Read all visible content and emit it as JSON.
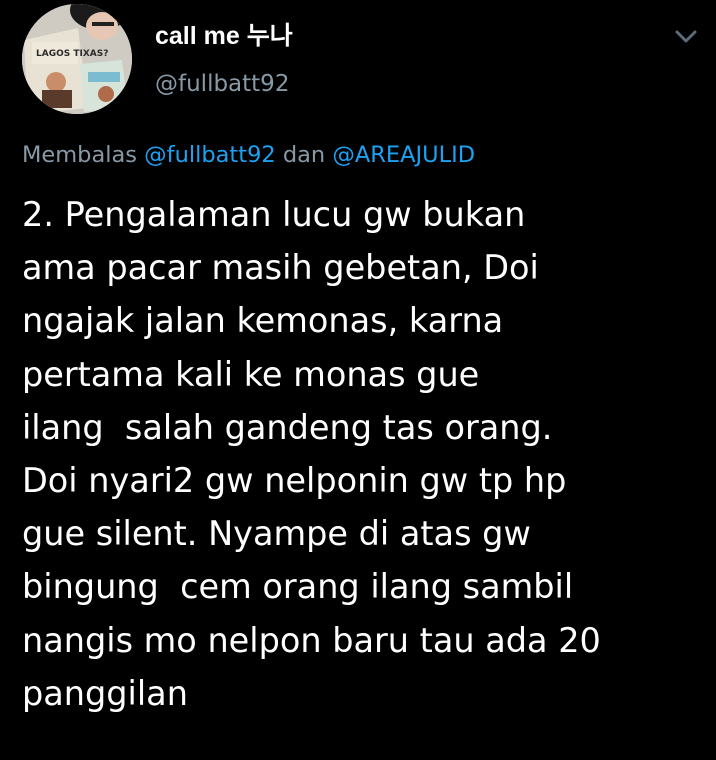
{
  "author": {
    "display_name": "call me 누나",
    "handle": "@fullbatt92",
    "avatar_book_text": "LAGOS TIXAS?"
  },
  "reply": {
    "prefix": "Membalas",
    "mention_1": "@fullbatt92",
    "joiner": "dan",
    "mention_2": "@AREAJULID"
  },
  "tweet": {
    "lines": [
      "2. Pengalaman lucu gw bukan",
      "ama pacar masih gebetan, Doi",
      "ngajak jalan kemonas, karna",
      "pertama kali ke monas gue",
      "ilang  salah gandeng tas orang.",
      "Doi nyari2 gw nelponin gw tp hp",
      "gue silent. Nyampe di atas gw",
      "bingung  cem orang ilang sambil",
      "nangis mo nelpon baru tau ada 20",
      "panggilan"
    ]
  },
  "icons": {
    "menu": "chevron-down-icon"
  },
  "colors": {
    "background": "#000000",
    "text": "#ffffff",
    "secondary": "#8899a6",
    "link": "#1da1f2"
  }
}
